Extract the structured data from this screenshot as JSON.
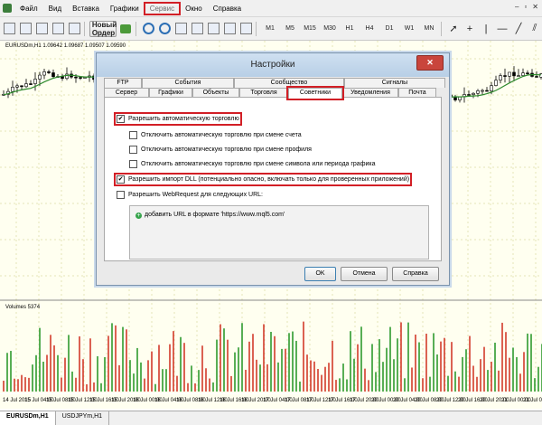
{
  "menu": [
    "Файл",
    "Вид",
    "Вставка",
    "Графики",
    "Сервис",
    "Окно",
    "Справка"
  ],
  "toolbar": {
    "new_order": "Новый Ордер",
    "periods": [
      "M1",
      "M5",
      "M15",
      "M30",
      "H1",
      "H4",
      "D1",
      "W1",
      "MN"
    ]
  },
  "chart": {
    "symbol_label": "EURUSDm,H1  1.09642 1.09687 1.09507 1.09590",
    "volume_label": "Volumes 5374",
    "dates": [
      "14 Jul 2015",
      "15 Jul 04:00",
      "15 Jul 08:00",
      "15 Jul 12:00",
      "15 Jul 16:00",
      "15 Jul 20:00",
      "16 Jul 00:00",
      "16 Jul 04:00",
      "16 Jul 08:00",
      "16 Jul 12:00",
      "16 Jul 16:00",
      "16 Jul 20:00",
      "17 Jul 04:00",
      "17 Jul 08:00",
      "17 Jul 12:00",
      "17 Jul 16:00",
      "17 Jul 20:00",
      "20 Jul 00:00",
      "20 Jul 04:00",
      "20 Jul 08:00",
      "20 Jul 12:00",
      "20 Jul 16:00",
      "20 Jul 20:00",
      "21 Jul 00:00",
      "21 Jul 04:00"
    ]
  },
  "bottom_tabs": [
    "EURUSDm,H1",
    "USDJPYm,H1"
  ],
  "dialog": {
    "title": "Настройки",
    "tabs_back": [
      "FTP",
      "События",
      "Сообщество",
      "Сигналы"
    ],
    "tabs_front": [
      "Сервер",
      "Графики",
      "Объекты",
      "Торговля",
      "Советники",
      "Уведомления",
      "Почта"
    ],
    "options": [
      {
        "label": "Разрешить автоматическую торговлю",
        "checked": true
      },
      {
        "label": "Отключить автоматическую торговлю при смене счета",
        "checked": false
      },
      {
        "label": "Отключить автоматическую торговлю при смене профиля",
        "checked": false
      },
      {
        "label": "Отключить автоматическую торговлю при смене символа или периода графика",
        "checked": false
      },
      {
        "label": "Разрешить импорт DLL (потенциально опасно, включать только для проверенных приложений)",
        "checked": true
      },
      {
        "label": "Разрешить WebRequest для следующих URL:",
        "checked": false
      }
    ],
    "url_hint": "добавить URL в формате 'https://www.mql5.com'",
    "buttons": {
      "ok": "OK",
      "cancel": "Отмена",
      "help": "Справка"
    }
  }
}
